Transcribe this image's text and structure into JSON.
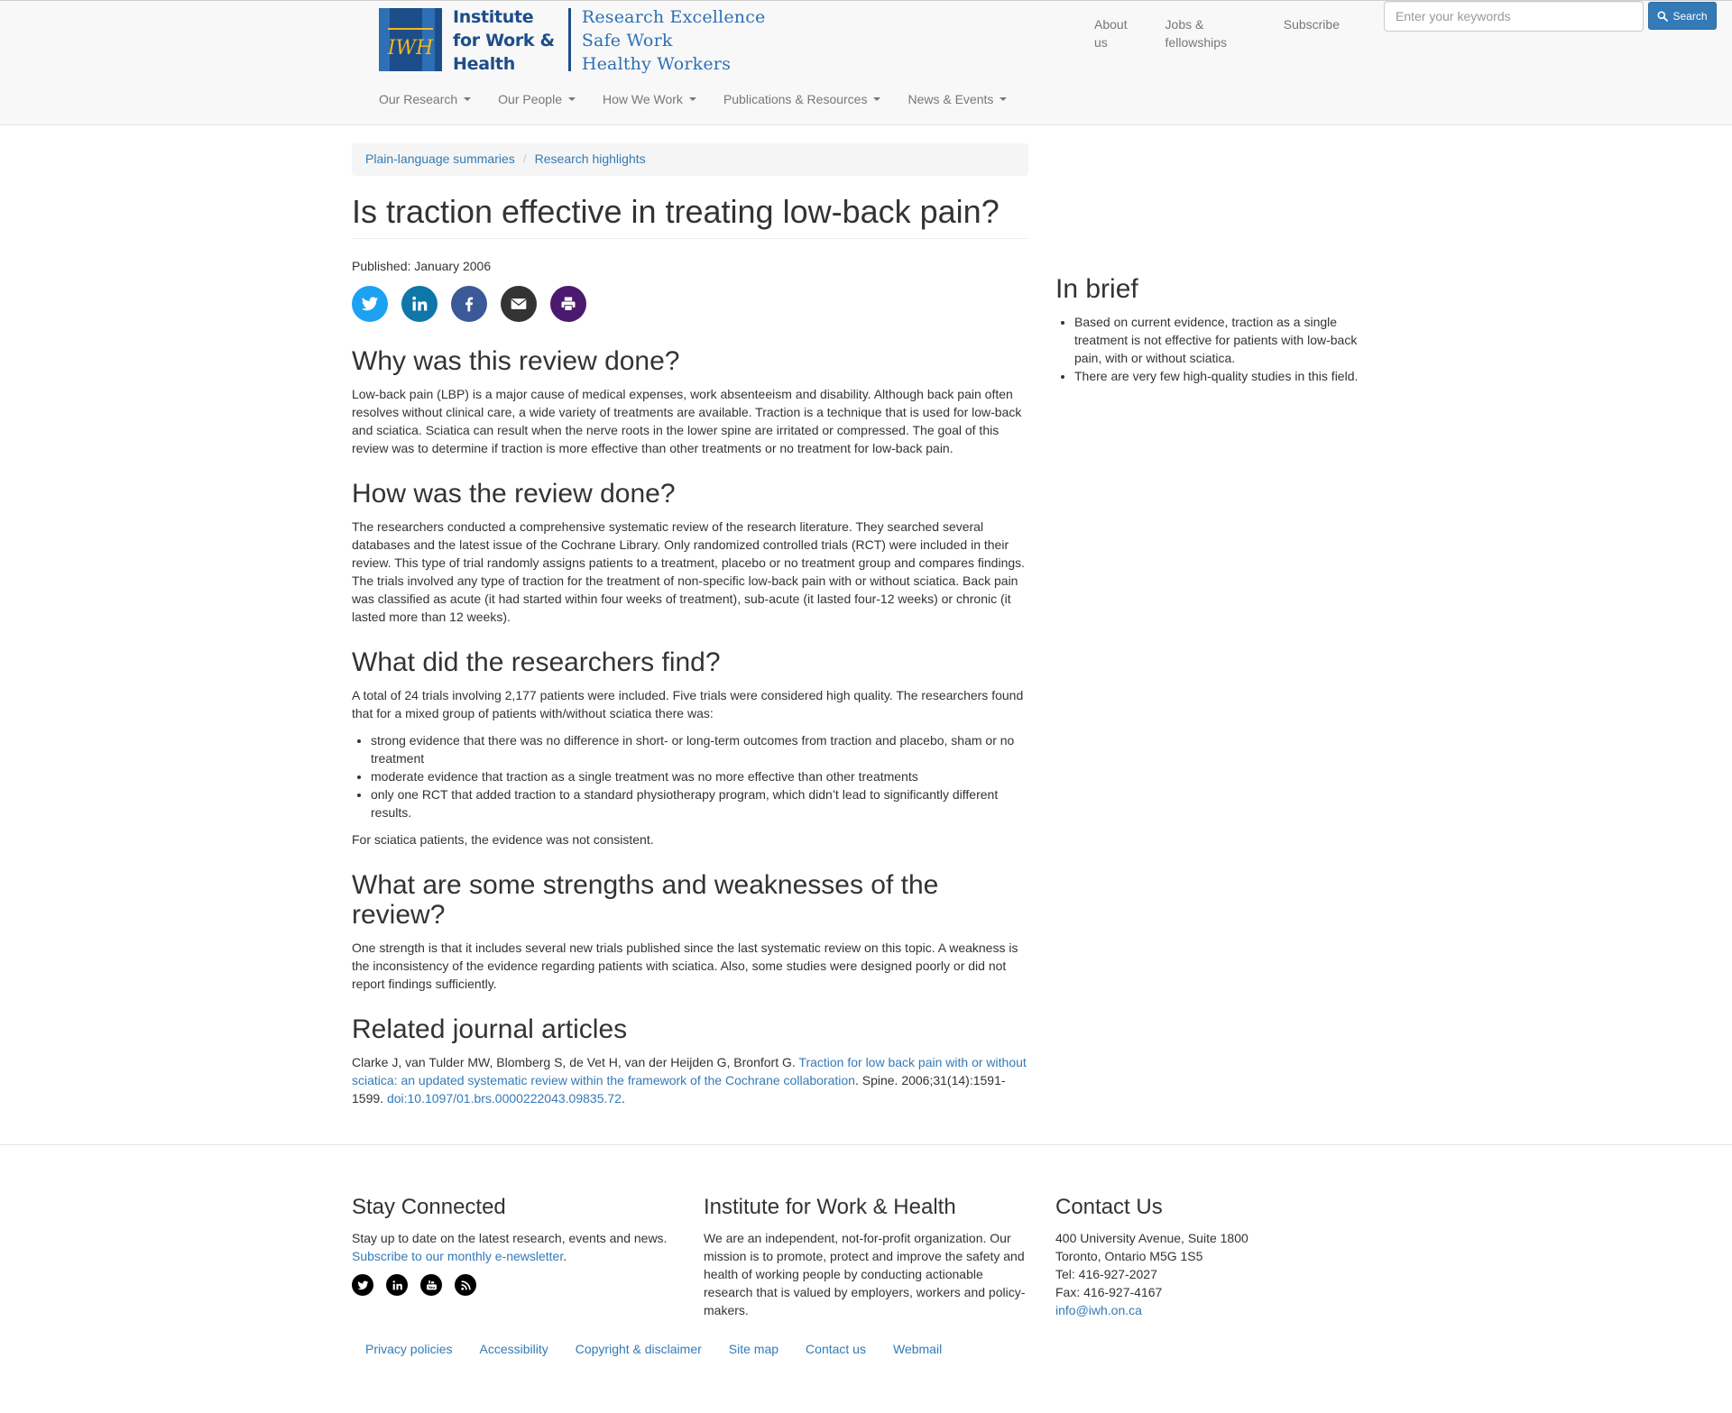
{
  "header": {
    "logo": {
      "name_lines": [
        "Institute",
        "for Work &",
        "Health"
      ],
      "tagline_lines": [
        "Research Excellence",
        "Safe Work",
        "Healthy Workers"
      ],
      "mark_text": "IWH"
    },
    "top_links": [
      "About us",
      "Jobs & fellowships",
      "Subscribe"
    ],
    "search": {
      "placeholder": "Enter your keywords",
      "button_label": "Search"
    },
    "nav": [
      "Our Research",
      "Our People",
      "How We Work",
      "Publications & Resources",
      "News & Events"
    ]
  },
  "breadcrumb": [
    "Plain-language summaries",
    "Research highlights"
  ],
  "article": {
    "title": "Is traction effective in treating low-back pain?",
    "published": "Published: January 2006",
    "share_icons": [
      "twitter-icon",
      "linkedin-icon",
      "facebook-icon",
      "email-icon",
      "print-icon"
    ],
    "sections": {
      "why": {
        "heading": "Why was this review done?",
        "text": "Low-back pain (LBP) is a major cause of medical expenses, work absenteeism and disability. Although back pain often resolves without clinical care, a wide variety of treatments are available. Traction is a technique that is used for low-back and sciatica. Sciatica can result when the nerve roots in the lower spine are irritated or compressed. The goal of this review was to determine if traction is more effective than other treatments or no treatment for low-back pain."
      },
      "how": {
        "heading": "How was the review done?",
        "text": "The researchers conducted a comprehensive systematic review of the research literature. They searched several databases and the latest issue of the Cochrane Library. Only randomized controlled trials (RCT) were included in their review. This type of trial randomly assigns patients to a treatment, placebo or no treatment group and compares findings. The trials involved any type of traction for the treatment of non-specific low-back pain with or without sciatica. Back pain was classified as acute (it had started within four weeks of treatment), sub-acute (it lasted four-12 weeks) or chronic (it lasted more than 12 weeks)."
      },
      "find": {
        "heading": "What did the researchers find?",
        "intro": "A total of 24 trials involving 2,177 patients were included. Five trials were considered high quality. The researchers found that for a mixed group of patients with/without sciatica there was:",
        "items": [
          "strong evidence that there was no difference in short- or long-term outcomes from traction and placebo, sham or no treatment",
          "moderate evidence that traction as a single treatment was no more effective than other treatments",
          "only one RCT that added traction to a standard physiotherapy program, which didn’t lead to significantly different results."
        ],
        "outro": "For sciatica patients, the evidence was not consistent."
      },
      "strengths": {
        "heading": "What are some strengths and weaknesses of the review?",
        "text": "One strength is that it includes several new trials published since the last systematic review on this topic. A weakness is the inconsistency of the evidence regarding patients with sciatica. Also, some studies were designed poorly or did not report findings sufficiently."
      },
      "related": {
        "heading": "Related journal articles",
        "authors": "Clarke J, van Tulder MW, Blomberg S, de Vet H, van der Heijden G, Bronfort G. ",
        "link_title": "Traction for low back pain with or without sciatica: an updated systematic review within the framework of the Cochrane collaboration",
        "citation": ". Spine. 2006;31(14):1591-1599. ",
        "doi": "doi:10.1097/01.brs.0000222043.09835.72",
        "end": "."
      }
    }
  },
  "sidebar": {
    "heading": "In brief",
    "items": [
      "Based on current evidence, traction as a single treatment is not effective for patients with low-back pain, with or without sciatica.",
      "There are very few high-quality studies in this field."
    ]
  },
  "footer": {
    "stay_connected": {
      "heading": "Stay Connected",
      "text": "Stay up to date on the latest research, events and news.",
      "link": "Subscribe to our monthly e-newsletter",
      "link_end": ".",
      "social_icons": [
        "twitter-icon",
        "linkedin-icon",
        "youtube-icon",
        "rss-icon"
      ]
    },
    "about": {
      "heading": "Institute for Work & Health",
      "text": "We are an independent, not-for-profit organization. Our mission is to promote, protect and improve the safety and health of working people by conducting actionable research that is valued by employers, workers and policy-makers."
    },
    "contact": {
      "heading": "Contact Us",
      "address1": "400 University Avenue, Suite 1800",
      "address2": "Toronto, Ontario M5G 1S5",
      "tel": "Tel: 416-927-2027",
      "fax": "Fax: 416-927-4167",
      "email": "info@iwh.on.ca"
    },
    "links": [
      "Privacy policies",
      "Accessibility",
      "Copyright & disclaimer",
      "Site map",
      "Contact us",
      "Webmail"
    ]
  },
  "colors": {
    "brand_blue": "#1d4d89",
    "brand_gold": "#f3b81f",
    "link": "#337ab7",
    "twitter": "#1da1f2",
    "linkedin": "#0e76a8",
    "facebook": "#3b5998",
    "email": "#333333",
    "print": "#4b1a6e"
  }
}
